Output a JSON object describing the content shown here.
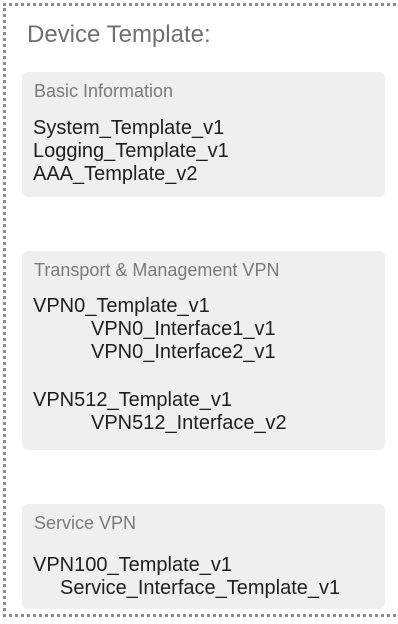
{
  "title": "Device Template:",
  "sections": [
    {
      "title": "Basic Information",
      "items": [
        "System_Template_v1",
        "Logging_Template_v1",
        "AAA_Template_v2"
      ]
    },
    {
      "title": "Transport & Management VPN",
      "items": [
        "VPN0_Template_v1",
        "VPN0_Interface1_v1",
        "VPN0_Interface2_v1",
        "VPN512_Template_v1",
        "VPN512_Interface_v2"
      ]
    },
    {
      "title": "Service VPN",
      "items": [
        "VPN100_Template_v1",
        "Service_Interface_Template_v1"
      ]
    }
  ]
}
